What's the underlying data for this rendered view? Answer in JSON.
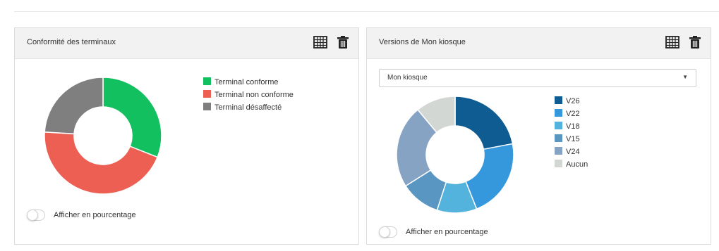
{
  "colors": {
    "conforme": "#13c05f",
    "non_conforme": "#ee5f53",
    "desaffecte": "#7f7f7f",
    "v26": "#0f5c92",
    "v22": "#3698dc",
    "v18": "#53b3dd",
    "v15": "#5a96c2",
    "v24": "#86a3c4",
    "aucun": "#d3d7d4"
  },
  "panel_left": {
    "title": "Conformité des terminaux",
    "icons": [
      "table-grid-icon",
      "trash-icon"
    ],
    "toggle_label": "Afficher en pourcentage",
    "toggle_on": false
  },
  "panel_right": {
    "title": "Versions de Mon kiosque",
    "icons": [
      "table-grid-icon",
      "trash-icon"
    ],
    "select_value": "Mon kiosque",
    "toggle_label": "Afficher en pourcentage",
    "toggle_on": false
  },
  "chart_data": [
    {
      "type": "pie",
      "variant": "donut",
      "categories": [
        "Terminal conforme",
        "Terminal non conforme",
        "Terminal désaffecté"
      ],
      "values": [
        31,
        45,
        24
      ],
      "colors": [
        "#13c05f",
        "#ee5f53",
        "#7f7f7f"
      ],
      "legend": "right"
    },
    {
      "type": "pie",
      "variant": "donut",
      "categories": [
        "V26",
        "V22",
        "V18",
        "V15",
        "V24",
        "Aucun"
      ],
      "values": [
        22,
        22,
        11,
        11,
        23,
        11
      ],
      "colors": [
        "#0f5c92",
        "#3698dc",
        "#53b3dd",
        "#5a96c2",
        "#86a3c4",
        "#d3d7d4"
      ],
      "legend": "right"
    }
  ]
}
